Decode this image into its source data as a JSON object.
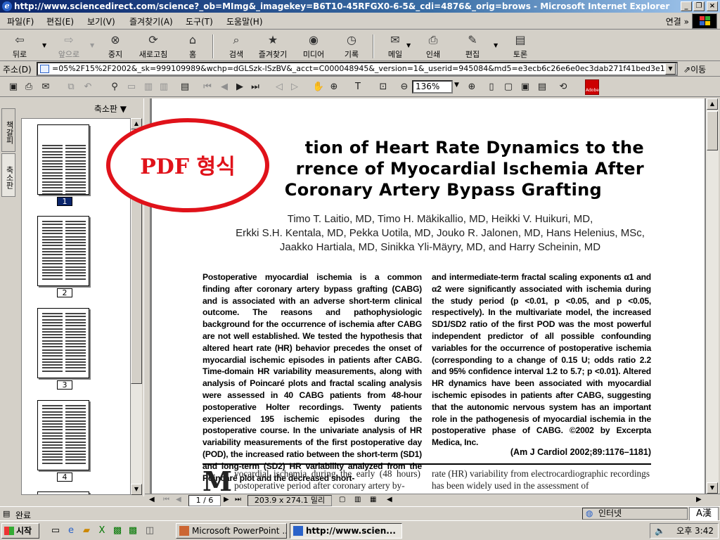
{
  "window": {
    "title": "http://www.sciencedirect.com/science?_ob=MImg&_imagekey=B6T10-45RFGX0-6-5&_cdi=4876&_orig=brows - Microsoft Internet Explorer"
  },
  "menu": {
    "items": [
      "파일(F)",
      "편집(E)",
      "보기(V)",
      "즐겨찾기(A)",
      "도구(T)",
      "도움말(H)"
    ],
    "links_label": "연결"
  },
  "toolbar": {
    "buttons": [
      {
        "label": "뒤로",
        "icon": "back-arrow-icon"
      },
      {
        "label": "앞으로",
        "icon": "forward-arrow-icon"
      },
      {
        "label": "중지",
        "icon": "stop-icon"
      },
      {
        "label": "새로고침",
        "icon": "refresh-icon"
      },
      {
        "label": "홈",
        "icon": "home-icon"
      },
      {
        "label": "검색",
        "icon": "search-icon"
      },
      {
        "label": "즐겨찾기",
        "icon": "favorites-icon"
      },
      {
        "label": "미디어",
        "icon": "media-icon"
      },
      {
        "label": "기록",
        "icon": "history-icon"
      },
      {
        "label": "메일",
        "icon": "mail-icon"
      },
      {
        "label": "인쇄",
        "icon": "print-icon"
      },
      {
        "label": "편집",
        "icon": "edit-icon"
      },
      {
        "label": "토론",
        "icon": "discuss-icon"
      }
    ]
  },
  "address": {
    "label": "주소(D)",
    "url": "=05%2F15%2F2002&_sk=999109989&wchp=dGLSzk-lSzBV&_acct=C000048945&_version=1&_userid=945084&md5=e3ecb6c26e6e0ec3dab271f41bed3e17&ie=f.pdf",
    "go_label": "이동"
  },
  "acrobat": {
    "zoom": "136%"
  },
  "side_tabs": [
    "책갈피",
    "축소판"
  ],
  "thumbnails": {
    "title": "축소판",
    "pages": [
      "1",
      "2",
      "3",
      "4"
    ],
    "selected": "1"
  },
  "doc_nav": {
    "page_count": "1 / 6",
    "page_size": "203.9 x 274.1 밀리"
  },
  "callout": {
    "text": "PDF 형식",
    "color": "#e0121a"
  },
  "article": {
    "title_lines": [
      "tion of Heart Rate Dynamics to the",
      "rrence of Myocardial Ischemia After",
      "Coronary Artery Bypass Grafting"
    ],
    "author_lines": [
      "Timo T. Laitio, MD, Timo H. Mäkikallio, MD, Heikki V. Huikuri, MD,",
      "Erkki S.H. Kentala, MD, Pekka Uotila, MD, Jouko R. Jalonen, MD, Hans Helenius, MSc,",
      "Jaakko Hartiala, MD, Sinikka Yli-Mäyry, MD, and Harry Scheinin, MD"
    ],
    "abstract_left": "Postoperative myocardial ischemia is a common finding after coronary artery bypass grafting (CABG) and is associated with an adverse short-term clinical outcome. The reasons and pathophysiologic background for the occurrence of ischemia after CABG are not well established. We tested the hypothesis that altered heart rate (HR) behavior precedes the onset of myocardial ischemic episodes in patients after CABG. Time-domain HR variability measurements, along with analysis of Poincaré plots and fractal scaling analysis were assessed in 40 CABG patients from 48-hour postoperative Holter recordings. Twenty patients experienced 195 ischemic episodes during the postoperative course. In the univariate analysis of HR variability measurements of the first postoperative day (POD), the increased ratio between the short-term (SD1) and long-term (SD2) HR variability analyzed from the Poincaré plot and the decreased short-",
    "abstract_right": "and intermediate-term fractal scaling exponents α1 and α2 were significantly associated with ischemia during the study period (p <0.01, p <0.05, and p <0.05, respectively). In the multivariate model, the increased SD1/SD2 ratio of the first POD was the most powerful independent predictor of all possible confounding variables for the occurrence of postoperative ischemia (corresponding to a change of 0.15 U; odds ratio 2.2 and 95% confidence interval 1.2 to 5.7; p <0.01). Altered HR dynamics have been associated with myocardial ischemic episodes in patients after CABG, suggesting that the autonomic nervous system has an important role in the pathogenesis of myocardial ischemia in the postoperative phase of CABG.   ©2002 by Excerpta Medica, Inc.",
    "citation": "(Am J Cardiol 2002;89:1176–1181)",
    "body_dropcap": "M",
    "body_left": "yocardial ischemia during the early (48 hours) postoperative period after coronary artery by-",
    "body_right": "rate (HR) variability from electrocardiographic recordings has been widely used in the assessment of"
  },
  "status": {
    "text": "완료",
    "zone": "인터넷",
    "ime": "A漢"
  },
  "taskbar": {
    "start": "시작",
    "tasks": [
      {
        "label": "Microsoft PowerPoint ...",
        "active": false
      },
      {
        "label": "http://www.scien...",
        "active": true
      }
    ],
    "clock": "오후 3:42"
  }
}
